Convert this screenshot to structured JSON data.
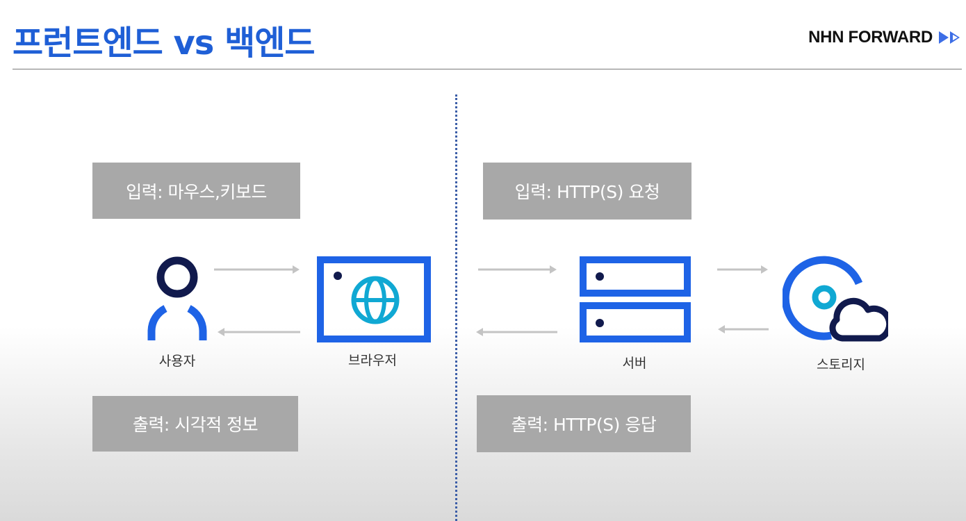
{
  "title": "프런트엔드 vs 백엔드",
  "brand": {
    "text": "NHN FORWARD",
    "icon": "double-play-icon",
    "color": "#3d6ee6"
  },
  "colors": {
    "title": "#1f5fd6",
    "accent_blue": "#1e63e6",
    "navy": "#111a4d",
    "cyan": "#10a8d3",
    "box_fill": "#a8a8a8",
    "arrow": "#c4c4c4",
    "divider": "#3c5ea8"
  },
  "frontend": {
    "input_box": "입력: 마우스,키보드",
    "output_box": "출력: 시각적 정보",
    "nodes": [
      {
        "label": "사용자",
        "icon": "user-icon"
      },
      {
        "label": "브라우저",
        "icon": "browser-globe-icon"
      }
    ]
  },
  "backend": {
    "input_box": "입력: HTTP(S) 요청",
    "output_box": "출력: HTTP(S) 응답",
    "nodes": [
      {
        "label": "서버",
        "icon": "server-icon"
      },
      {
        "label": "스토리지",
        "icon": "storage-cloud-icon"
      }
    ]
  }
}
